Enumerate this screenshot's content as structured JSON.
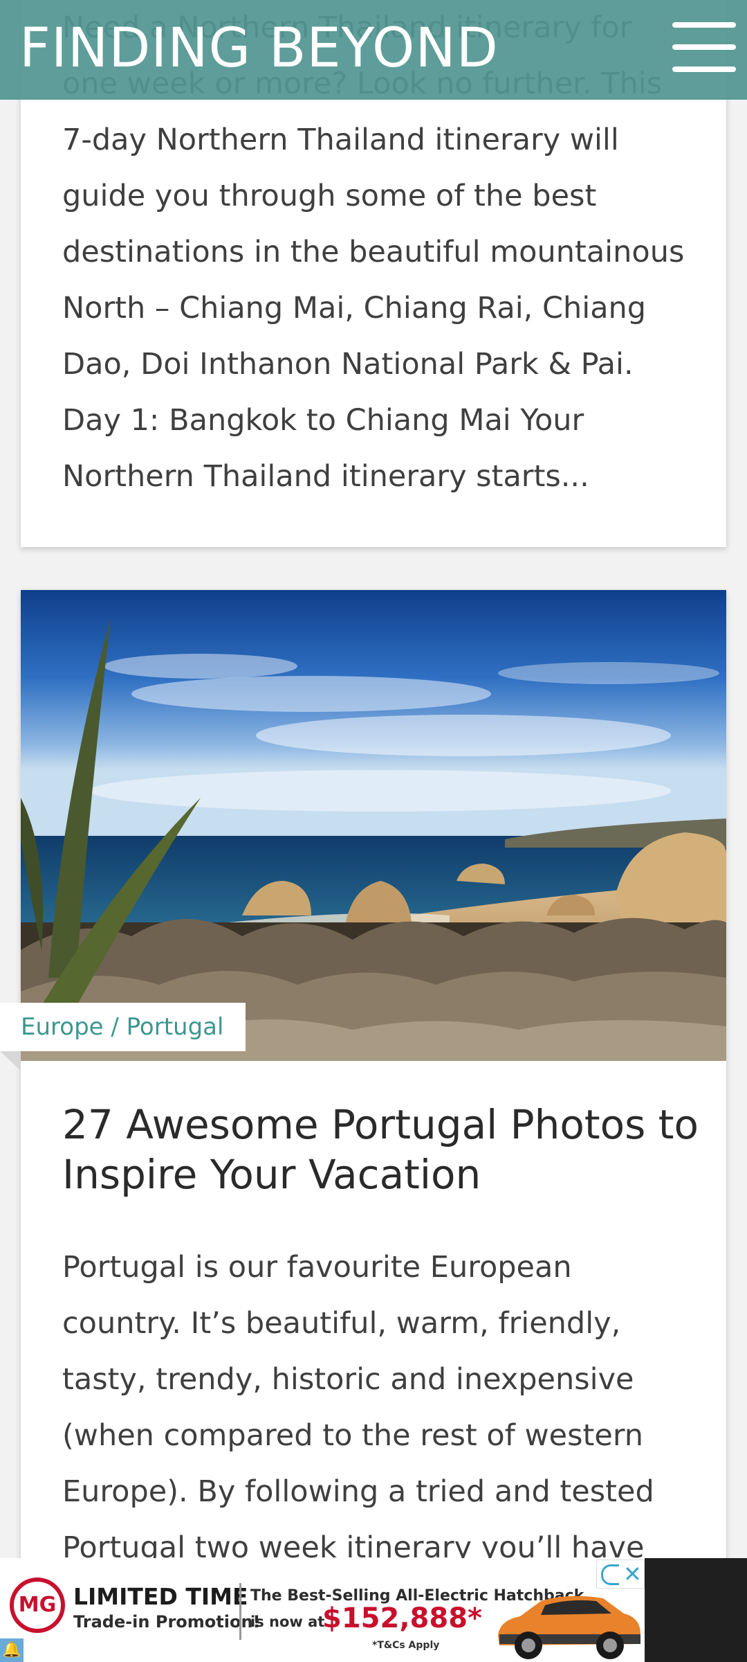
{
  "header": {
    "logo_text": "FINDING BEYOND",
    "menu_icon": "hamburger-menu-icon",
    "background_color": "#529691"
  },
  "posts": [
    {
      "excerpt": "Need a Northern Thailand itinerary for one week or more? Look no further. This 7-day Northern Thailand itinerary will guide you through some of the best destinations in the beautiful mountainous North – Chiang Mai, Chiang Rai, Chiang Dao, Doi Inthanon National Park & Pai. Day 1: Bangkok to Chiang Mai Your Northern Thailand itinerary starts..."
    },
    {
      "category": "Europe / Portugal",
      "title": "27 Awesome Portugal Photos to Inspire Your Vacation",
      "excerpt": "Portugal is our favourite European country. It’s beautiful, warm, friendly, tasty, trendy, historic and inexpensive (when compared to the rest of western Europe). By following a tried and tested Portugal two week itinerary you’ll have"
    }
  ],
  "ad": {
    "brand": "MG",
    "headline": "LIMITED TIME",
    "subline": "Trade-in Promotion!",
    "copy_line1": "The Best-Selling All-Electric Hatchback",
    "copy_line2": "is now at",
    "price": "$152,888*",
    "terms": "*T&Cs Apply",
    "adchoices_icon": "adchoices-icon",
    "close_icon": "close-icon",
    "accent_color": "#c8102e"
  }
}
